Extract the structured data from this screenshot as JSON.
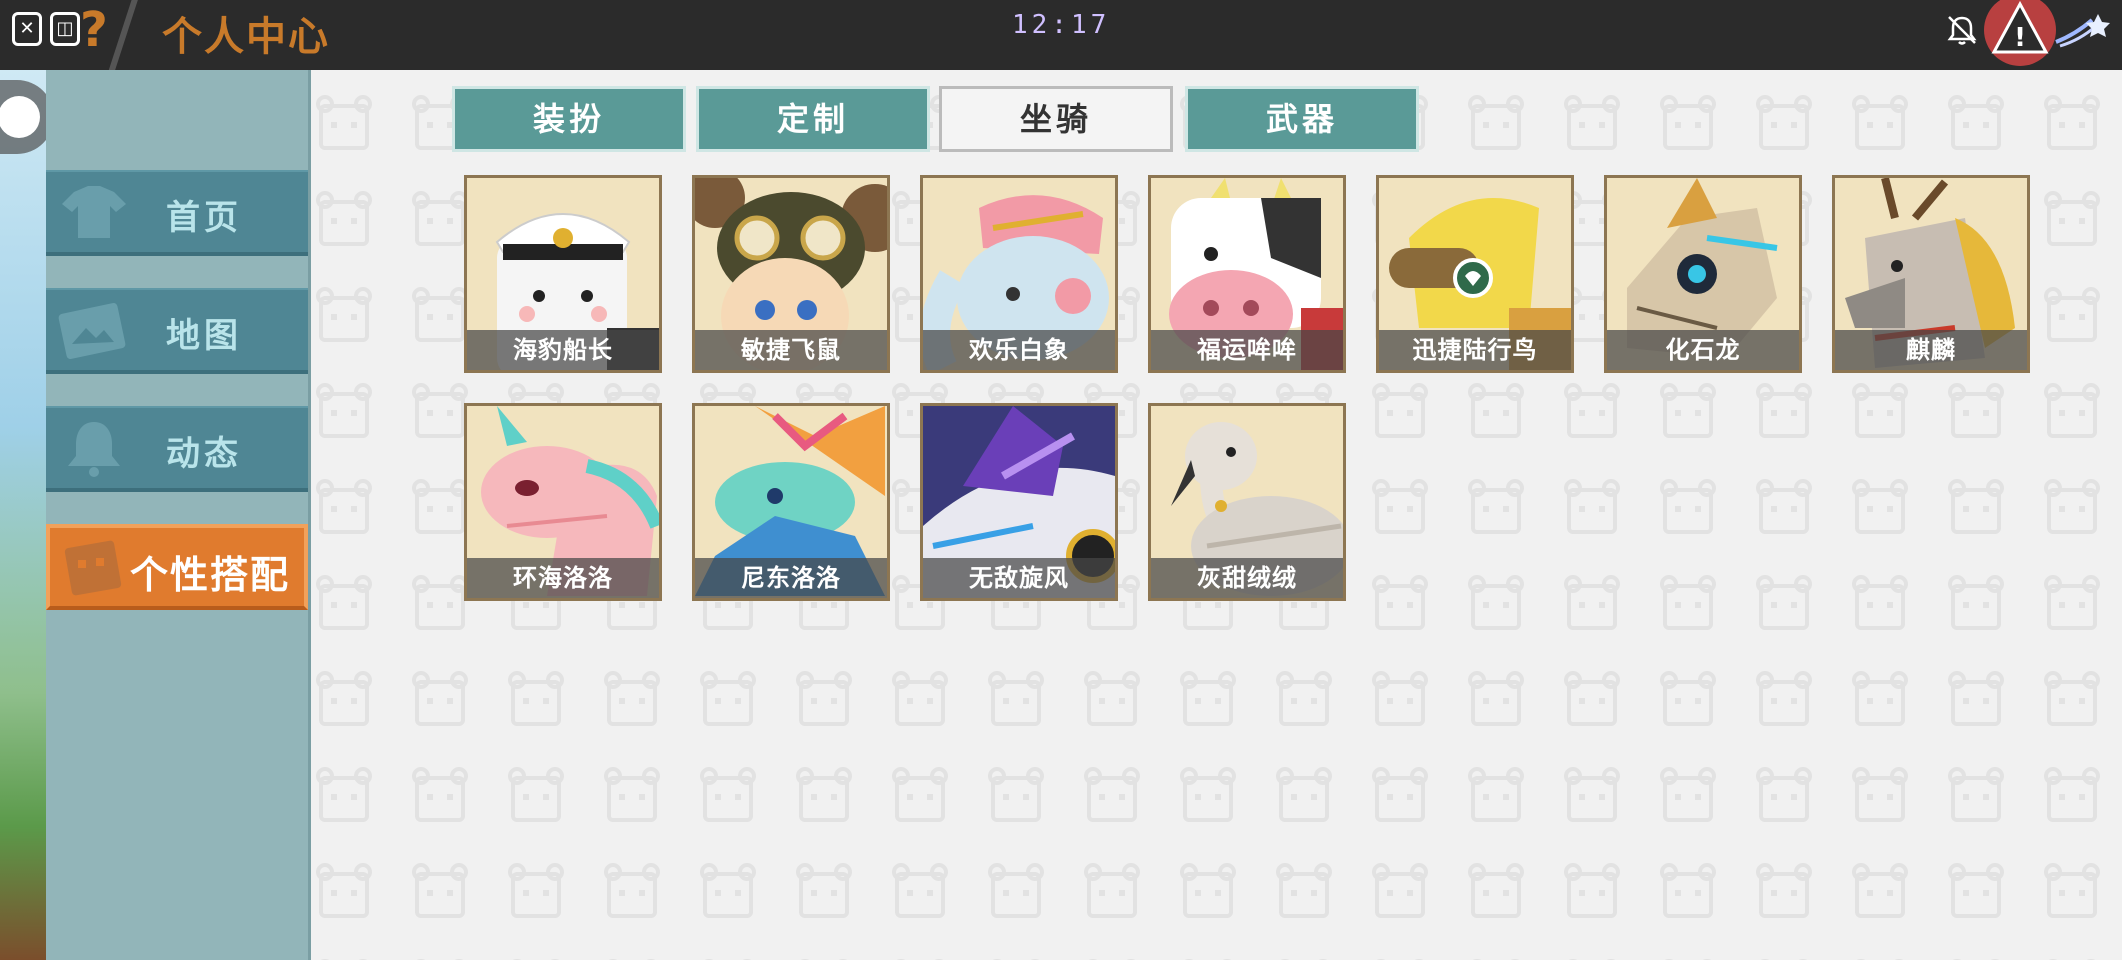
{
  "header": {
    "title": "个人中心",
    "clock": "12:17"
  },
  "sidebar": {
    "items": [
      {
        "label": "首页",
        "icon": "shirt-icon"
      },
      {
        "label": "地图",
        "icon": "map-icon"
      },
      {
        "label": "动态",
        "icon": "bell-icon"
      },
      {
        "label": "个性搭配",
        "icon": "character-icon",
        "active": true
      }
    ]
  },
  "tabs": [
    {
      "label": "装扮"
    },
    {
      "label": "定制"
    },
    {
      "label": "坐骑",
      "active": true
    },
    {
      "label": "武器"
    }
  ],
  "mounts": [
    {
      "name": "海豹船长",
      "color": "#f5f5f5"
    },
    {
      "name": "敏捷飞鼠",
      "color": "#7a5a3a"
    },
    {
      "name": "欢乐白象",
      "color": "#cfe4ef"
    },
    {
      "name": "福运哞哞",
      "color": "#ffffff"
    },
    {
      "name": "迅捷陆行鸟",
      "color": "#f2d84a"
    },
    {
      "name": "化石龙",
      "color": "#d7c6a8"
    },
    {
      "name": "麒麟",
      "color": "#c7bdb2"
    },
    {
      "name": "环海洛洛",
      "color": "#f6b8bc"
    },
    {
      "name": "尼东洛洛",
      "color": "#6fd3c4"
    },
    {
      "name": "无敌旋风",
      "color": "#6a3fb8"
    },
    {
      "name": "灰甜绒绒",
      "color": "#d9d3cb"
    }
  ]
}
